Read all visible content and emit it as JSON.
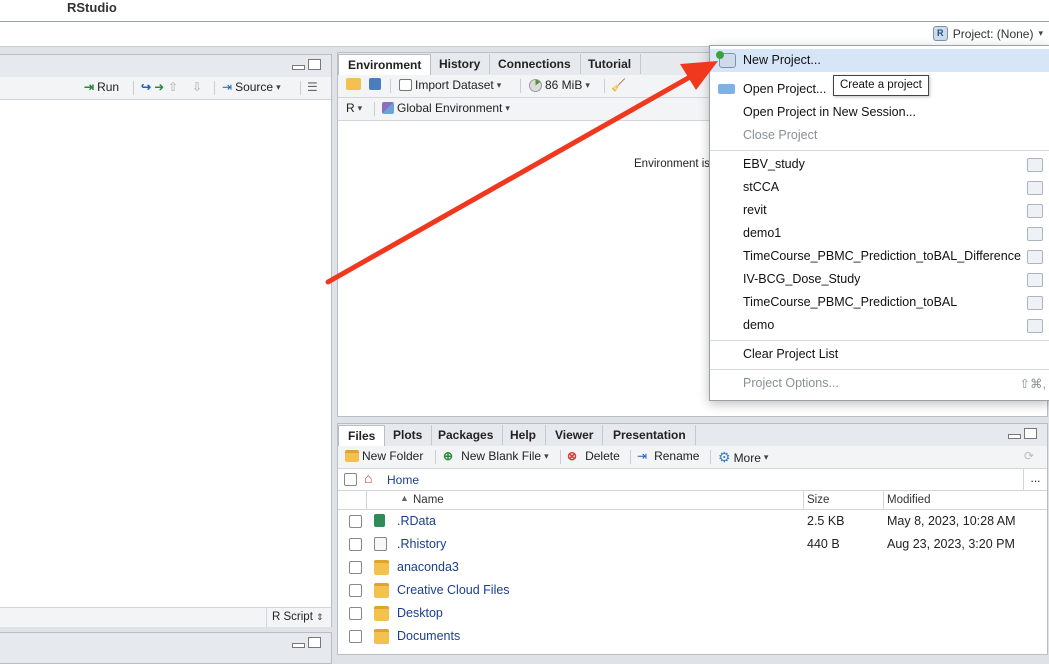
{
  "app": {
    "title": "RStudio"
  },
  "project_bar": {
    "label": "Project: (None)",
    "icon": "r-project-icon"
  },
  "source_pane": {
    "toolbar": {
      "run_label": "Run",
      "source_label": "Source"
    },
    "status": {
      "file_type": "R Script"
    }
  },
  "env_pane": {
    "tabs": [
      {
        "label": "Environment"
      },
      {
        "label": "History"
      },
      {
        "label": "Connections"
      },
      {
        "label": "Tutorial"
      }
    ],
    "toolbar": {
      "import_label": "Import Dataset",
      "memory_label": "86 MiB",
      "lang_label": "R",
      "scope_label": "Global Environment"
    },
    "empty_text": "Environment is"
  },
  "project_menu": {
    "new_project": "New Project...",
    "open_project": "Open Project...",
    "open_new_session": "Open Project in New Session...",
    "close_project": "Close Project",
    "recent": [
      "EBV_study",
      "stCCA",
      "revit",
      "demo1",
      "TimeCourse_PBMC_Prediction_toBAL_Difference",
      "IV-BCG_Dose_Study",
      "TimeCourse_PBMC_Prediction_toBAL",
      "demo"
    ],
    "clear_list": "Clear Project List",
    "options": "Project Options...",
    "options_shortcut": "⇧⌘,",
    "tooltip": "Create a project"
  },
  "files_pane": {
    "tabs": [
      {
        "label": "Files"
      },
      {
        "label": "Plots"
      },
      {
        "label": "Packages"
      },
      {
        "label": "Help"
      },
      {
        "label": "Viewer"
      },
      {
        "label": "Presentation"
      }
    ],
    "toolbar": {
      "new_folder": "New Folder",
      "new_blank_file": "New Blank File",
      "delete": "Delete",
      "rename": "Rename",
      "more": "More"
    },
    "breadcrumb": "Home",
    "ellipsis": "...",
    "columns": {
      "name": "Name",
      "size": "Size",
      "modified": "Modified"
    },
    "rows": [
      {
        "name": ".RData",
        "size": "2.5 KB",
        "modified": "May 8, 2023, 10:28 AM"
      },
      {
        "name": ".Rhistory",
        "size": "440 B",
        "modified": "Aug 23, 2023, 3:20 PM"
      },
      {
        "name": "anaconda3",
        "size": "",
        "modified": ""
      },
      {
        "name": "Creative Cloud Files",
        "size": "",
        "modified": ""
      },
      {
        "name": "Desktop",
        "size": "",
        "modified": ""
      },
      {
        "name": "Documents",
        "size": "",
        "modified": ""
      }
    ]
  },
  "colors": {
    "arrow": "#f0381f",
    "link": "#1a3f8c",
    "highlight": "#d6e6f7"
  }
}
